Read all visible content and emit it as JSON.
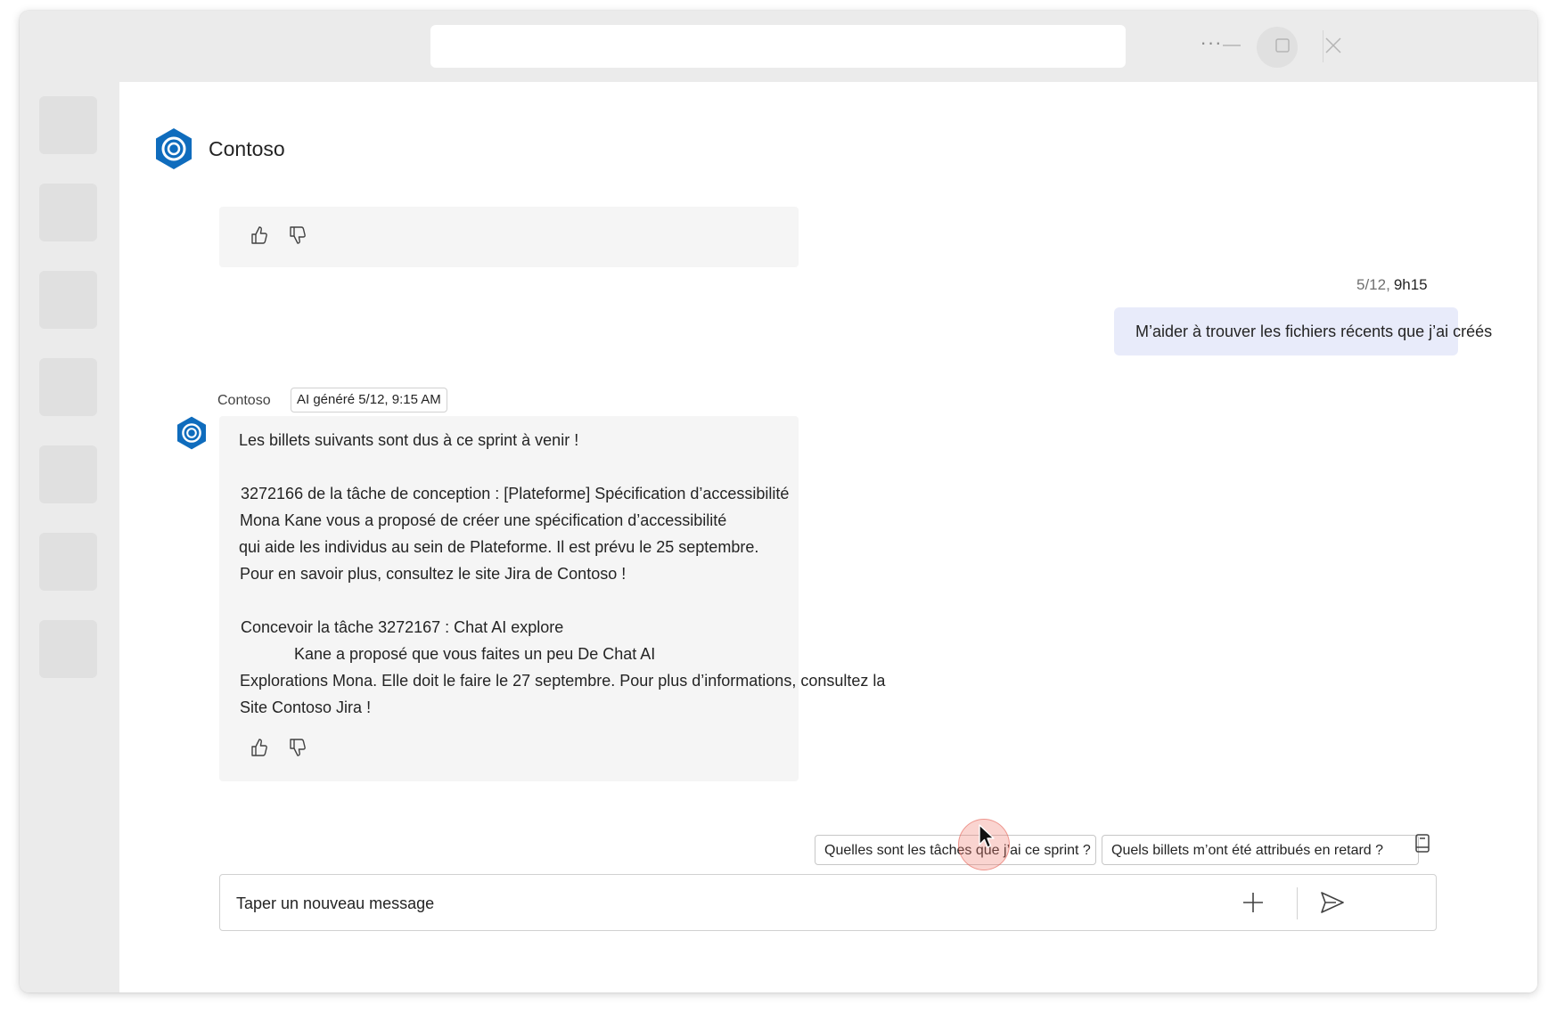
{
  "app": {
    "name": "Contoso",
    "brand_color": "#0f6cbd"
  },
  "titlebar": {
    "search_value": "",
    "more_label": "···"
  },
  "sidebar": {
    "items": [
      {
        "id": "rail-1"
      },
      {
        "id": "rail-2"
      },
      {
        "id": "rail-3"
      },
      {
        "id": "rail-4"
      },
      {
        "id": "rail-5"
      },
      {
        "id": "rail-6"
      },
      {
        "id": "rail-7"
      }
    ]
  },
  "user_message": {
    "date": "5/12,",
    "time": "9h15",
    "text": "M’aider à trouver les fichiers récents que j’ai créés",
    "bubble_color": "#e8ebfa"
  },
  "bot_message": {
    "sender": "Contoso",
    "tag": "AI généré 5/12, 9:15 AM",
    "lines": [
      "Les billets suivants sont dus à ce sprint à venir !",
      "3272166 de la tâche de conception : [Plateforme] Spécification d’accessibilité",
      "Mona   Kane vous a proposé de créer une spécification d’accessibilité",
      "qui aide les individus au sein de     Plateforme. Il est prévu le 25 septembre.",
      "Pour en savoir plus, consultez le site Jira de Contoso !",
      "Concevoir la tâche 3272167 : Chat AI explore",
      "Kane a proposé que vous faites un peu De Chat AI",
      "Explorations Mona. Elle doit le faire le 27 septembre. Pour plus d’informations, consultez la",
      "Site Contoso Jira !"
    ],
    "bubble_color": "#f5f5f5"
  },
  "suggestions": [
    "Quelles sont les tâches que j’ai ce sprint ?",
    "Quels billets m’ont été attribués en retard ?"
  ],
  "composer": {
    "placeholder": "Taper un nouveau message"
  }
}
